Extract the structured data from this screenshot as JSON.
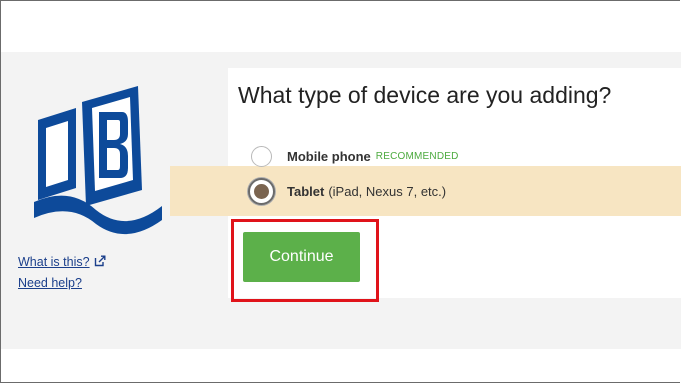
{
  "prompt": {
    "title": "What type of device are you adding?"
  },
  "options": [
    {
      "label": "Mobile phone",
      "badge": "RECOMMENDED",
      "detail": "",
      "selected": false
    },
    {
      "label": "Tablet",
      "badge": "",
      "detail": "(iPad, Nexus 7, etc.)",
      "selected": true
    }
  ],
  "actions": {
    "continue_label": "Continue"
  },
  "side_links": {
    "what_is_this": "What is this?",
    "need_help": "Need help?"
  },
  "colors": {
    "accent_green": "#5cb04a",
    "selected_row": "#f7e5c2",
    "logo_blue": "#0d4a9a",
    "highlight_red": "#e0131a",
    "link_blue": "#1b3f8b"
  },
  "icons": {
    "logo": "book-logo",
    "external_link": "external-link-icon"
  }
}
